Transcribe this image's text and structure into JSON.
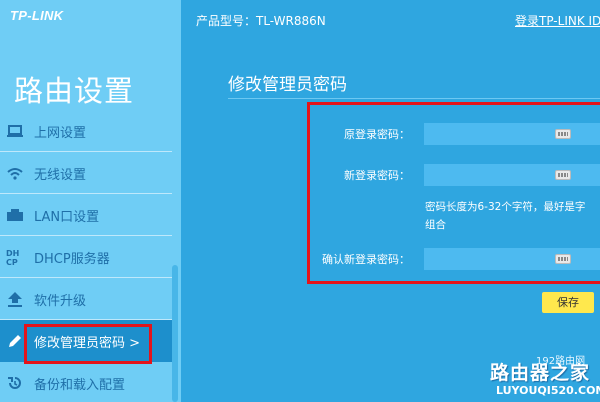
{
  "brand": "TP-LINK",
  "topbar": {
    "model": "产品型号：TL-WR886N",
    "login_link": "登录TP-LINK ID"
  },
  "sidebar": {
    "title": "路由设置",
    "items": [
      {
        "label": "上网设置",
        "icon": "laptop-icon"
      },
      {
        "label": "无线设置",
        "icon": "wifi-icon"
      },
      {
        "label": "LAN口设置",
        "icon": "lan-port-icon"
      },
      {
        "label": "DHCP服务器",
        "icon": "dhcp-icon"
      },
      {
        "label": "软件升级",
        "icon": "upload-arrow-icon"
      },
      {
        "label": "修改管理员密码 >",
        "icon": "pencil-icon",
        "active": true
      },
      {
        "label": "备份和载入配置",
        "icon": "restore-icon"
      }
    ]
  },
  "main": {
    "title": "修改管理员密码",
    "fields": {
      "old_password_label": "原登录密码：",
      "new_password_label": "新登录密码：",
      "confirm_password_label": "确认新登录密码：",
      "old_password_value": "",
      "new_password_value": "",
      "confirm_password_value": ""
    },
    "hint_line1": "密码长度为6-32个字符，最好是字",
    "hint_line2": "组合",
    "save_label": "保存"
  },
  "watermark": {
    "line1": "路由器之家",
    "line2": "LUYOUQI520.COM",
    "arc_text": "192路由网"
  },
  "colors": {
    "main_bg": "#2fa6e0",
    "sidebar_bg": "#6fcdf5",
    "active_item_bg": "#1d8fcc",
    "highlight_border": "#e4141b",
    "save_button": "#ffe84d",
    "input_bg": "#4dbaf0"
  }
}
